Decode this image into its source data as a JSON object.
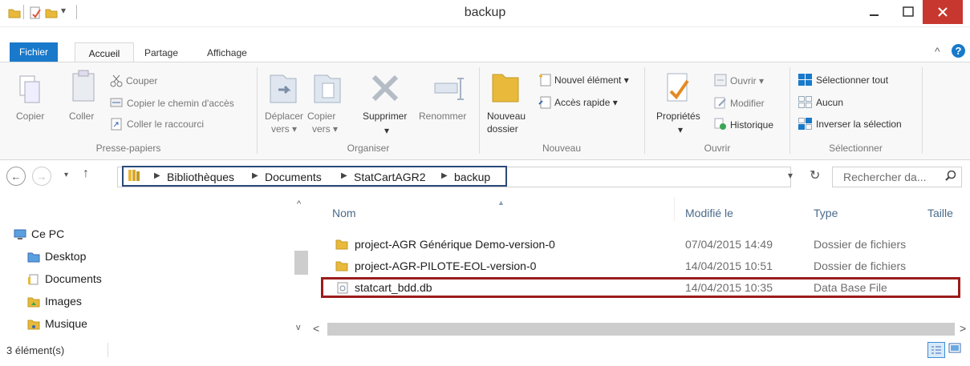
{
  "window": {
    "title": "backup"
  },
  "ribbon": {
    "tabs": {
      "fichier": "Fichier",
      "accueil": "Accueil",
      "partage": "Partage",
      "affichage": "Affichage"
    },
    "presse_papiers": {
      "copier": "Copier",
      "coller": "Coller",
      "couper": "Couper",
      "copier_chemin": "Copier le chemin d'accès",
      "coller_raccourci": "Coller le raccourci",
      "group": "Presse-papiers"
    },
    "organiser": {
      "deplacer_1": "Déplacer",
      "deplacer_2": "vers ▾",
      "copier_1": "Copier",
      "copier_2": "vers ▾",
      "supprimer": "Supprimer",
      "supprimer_arrow": "▾",
      "renommer": "Renommer",
      "group": "Organiser"
    },
    "nouveau": {
      "nouveau_dossier_1": "Nouveau",
      "nouveau_dossier_2": "dossier",
      "nouvel_element": "Nouvel élément ▾",
      "acces_rapide": "Accès rapide ▾",
      "group": "Nouveau"
    },
    "ouvrir": {
      "proprietes": "Propriétés",
      "proprietes_arrow": "▾",
      "ouvrir": "Ouvrir ▾",
      "modifier": "Modifier",
      "historique": "Historique",
      "group": "Ouvrir"
    },
    "selectionner": {
      "tout": "Sélectionner tout",
      "aucun": "Aucun",
      "inverser": "Inverser la sélection",
      "group": "Sélectionner"
    }
  },
  "address": {
    "crumbs": [
      "Bibliothèques",
      "Documents",
      "StatCartAGR2",
      "backup"
    ],
    "search_placeholder": "Rechercher da..."
  },
  "nav_pane": {
    "items": [
      "Ce PC",
      "Desktop",
      "Documents",
      "Images",
      "Musique"
    ]
  },
  "columns": {
    "name": "Nom",
    "modified": "Modifié le",
    "type": "Type",
    "size": "Taille"
  },
  "files": [
    {
      "name": "project-AGR Générique Demo-version-0",
      "modified": "07/04/2015 14:49",
      "type": "Dossier de fichiers",
      "icon": "folder-icon"
    },
    {
      "name": "project-AGR-PILOTE-EOL-version-0",
      "modified": "14/04/2015 10:51",
      "type": "Dossier de fichiers",
      "icon": "folder-icon"
    },
    {
      "name": "statcart_bdd.db",
      "modified": "14/04/2015 10:35",
      "type": "Data Base File",
      "icon": "database-file-icon"
    }
  ],
  "status": {
    "count": "3 élément(s)"
  },
  "colors": {
    "accent": "#1979ca",
    "highlight_border": "#9b1c1c",
    "address_border": "#2a4a7a",
    "folder": "#e8b93a"
  }
}
